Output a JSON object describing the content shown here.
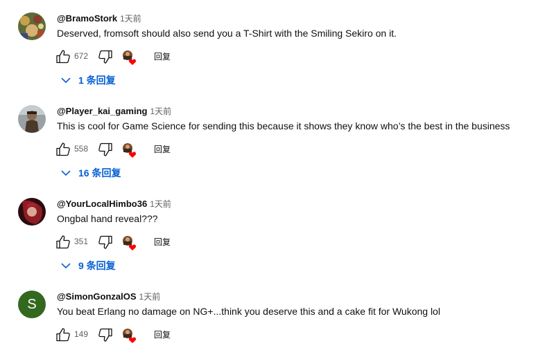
{
  "comments": [
    {
      "author": "@BramoStork",
      "time": "1天前",
      "text": "Deserved, fromsoft should also send you a T-Shirt with the Smiling Sekiro on it.",
      "likes": "672",
      "reply_label": "回复",
      "replies_label": "1 条回复"
    },
    {
      "author": "@Player_kai_gaming",
      "time": "1天前",
      "text": "This is cool for Game Science for sending this because it shows they know who’s the best in the business",
      "likes": "558",
      "reply_label": "回复",
      "replies_label": "16 条回复"
    },
    {
      "author": "@YourLocalHimbo36",
      "time": "1天前",
      "text": "Ongbal hand reveal???",
      "likes": "351",
      "reply_label": "回复",
      "replies_label": "9 条回复"
    },
    {
      "author": "@SimonGonzalOS",
      "time": "1天前",
      "text": "You beat Erlang no damage on NG+...think you deserve this and a cake fit for Wukong lol",
      "likes": "149",
      "reply_label": "回复",
      "avatar_letter": "S"
    }
  ],
  "colors": {
    "link_blue": "#065fd4",
    "secondary_text": "#606060",
    "heart_red": "#ff0000",
    "letter_avatar_bg": "#33691e"
  },
  "icons": [
    "thumb-up-icon",
    "thumb-down-icon",
    "creator-heart-icon",
    "chevron-down-icon"
  ]
}
